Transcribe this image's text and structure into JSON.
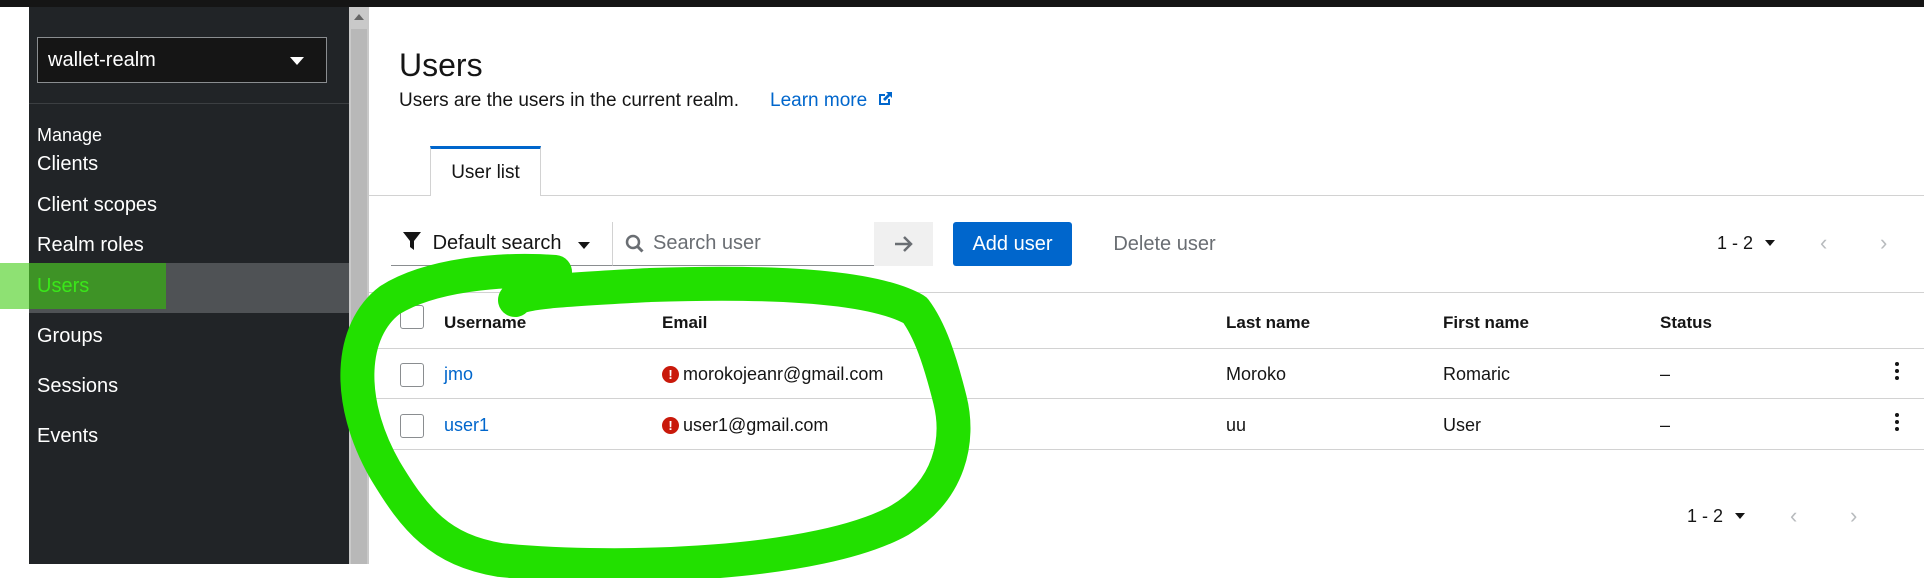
{
  "sidebar": {
    "realm": "wallet-realm",
    "section": "Manage",
    "items": [
      {
        "label": "Clients"
      },
      {
        "label": "Client scopes"
      },
      {
        "label": "Realm roles"
      },
      {
        "label": "Users",
        "active": true
      },
      {
        "label": "Groups"
      },
      {
        "label": "Sessions"
      },
      {
        "label": "Events"
      }
    ]
  },
  "page": {
    "title": "Users",
    "description": "Users are the users in the current realm.",
    "learn_more": "Learn more"
  },
  "tabs": [
    {
      "label": "User list",
      "selected": true
    }
  ],
  "toolbar": {
    "filter_label": "Default search",
    "search_placeholder": "Search user",
    "add_label": "Add user",
    "delete_label": "Delete user",
    "pagination": "1 - 2"
  },
  "table": {
    "columns": [
      "Username",
      "Email",
      "Last name",
      "First name",
      "Status"
    ],
    "rows": [
      {
        "username": "jmo",
        "email": "morokojeanr@gmail.com",
        "last_name": "Moroko",
        "first_name": "Romaric",
        "status": "–"
      },
      {
        "username": "user1",
        "email": "user1@gmail.com",
        "last_name": "uu",
        "first_name": "User",
        "status": "–"
      }
    ],
    "pagination_bottom": "1 - 2"
  },
  "colors": {
    "accent": "#0066cc",
    "sidebar_bg": "#212427",
    "annotation": "#22e000",
    "error": "#c9190b"
  }
}
